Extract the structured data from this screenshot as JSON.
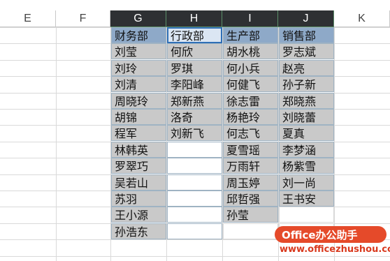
{
  "columns": [
    "E",
    "F",
    "G",
    "H",
    "I",
    "J",
    "K"
  ],
  "selected_columns": [
    "G",
    "H",
    "I",
    "J"
  ],
  "table": {
    "G": [
      "财务部",
      "刘莹",
      "刘玲",
      "刘清",
      "周晓玲",
      "胡锦",
      "程军",
      "林韩英",
      "罗翠巧",
      "吴若山",
      "苏羽",
      "王小源",
      "孙浩东"
    ],
    "H": [
      "行政部",
      "何欣",
      "罗琪",
      "李阳峰",
      "郑新燕",
      "洛奇",
      "刘新飞",
      "",
      "",
      "",
      "",
      "",
      ""
    ],
    "I": [
      "生产部",
      "胡水桃",
      "何小兵",
      "何健飞",
      "徐志雷",
      "杨艳玲",
      "何志飞",
      "夏雪瑶",
      "万雨轩",
      "周玉婷",
      "邱哲强",
      "孙莹",
      ""
    ],
    "J": [
      "销售部",
      "罗志斌",
      "赵亮",
      "孙子新",
      "郑晓燕",
      "刘晓蕾",
      "夏真",
      "李梦涵",
      "杨紫雪",
      "刘一尚",
      "王书安",
      "",
      ""
    ]
  },
  "watermark": {
    "badge": "Office办公助手",
    "url": "www.officezhushou.com"
  },
  "colors": {
    "header_fill": "#8ea9c8",
    "cell_fill": "#c9c9c9",
    "selected_col_header": "#2e3033",
    "watermark": "#e54a2a"
  }
}
